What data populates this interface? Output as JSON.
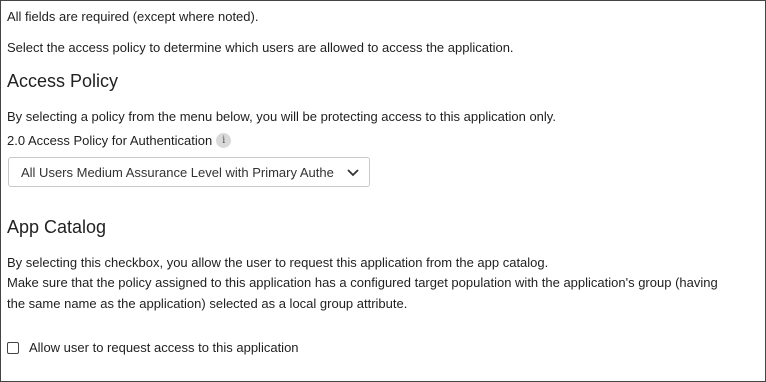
{
  "intro": {
    "required_note": "All fields are required (except where noted).",
    "select_policy_text": "Select the access policy to determine which users are allowed to access the application."
  },
  "access_policy": {
    "heading": "Access Policy",
    "description": "By selecting a policy from the menu below, you will be protecting access to this application only.",
    "field_label": "2.0 Access Policy for Authentication",
    "info_icon": "info-icon",
    "selected_value": "All Users Medium Assurance Level with Primary Authe"
  },
  "app_catalog": {
    "heading": "App Catalog",
    "line1": "By selecting this checkbox, you allow the user to request this application from the app catalog.",
    "line2": "Make sure that the policy assigned to this application has a configured target population with the application's group (having",
    "line3": "the same name as the application) selected as a local group attribute.",
    "checkbox_label": "Allow user to request access to this application",
    "checkbox_checked": false
  }
}
